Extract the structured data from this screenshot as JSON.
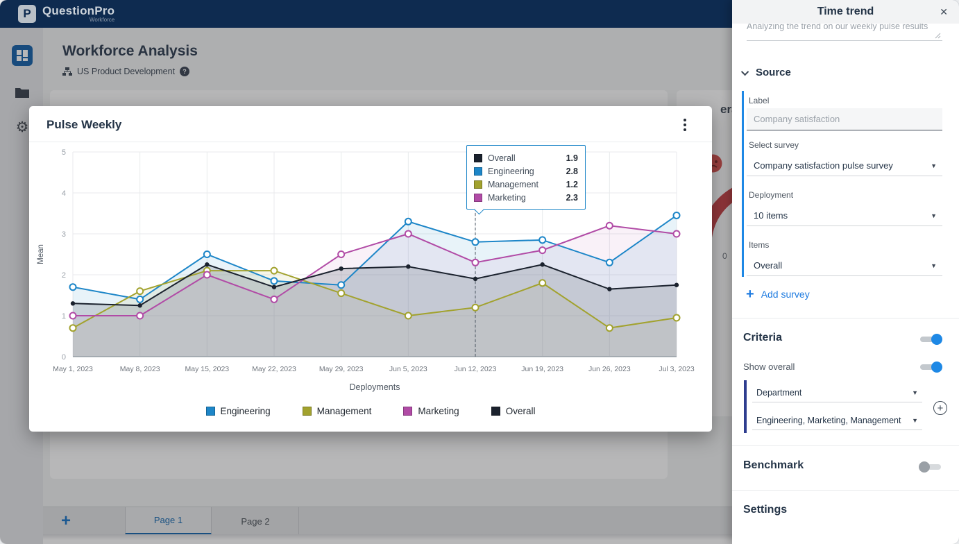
{
  "navbar": {
    "brand": "QuestionPro",
    "brand_sub": "Workforce",
    "logo_letter": "P"
  },
  "page": {
    "title": "Workforce Analysis",
    "breadcrumb": "US Product Development",
    "help": "?"
  },
  "background": {
    "card_title_fragment": "era",
    "gauge_tick": "0"
  },
  "tabs": {
    "add": "+",
    "page1": "Page 1",
    "page2": "Page 2"
  },
  "modal": {
    "title": "Pulse Weekly"
  },
  "chart_data": {
    "type": "line",
    "title": "Pulse Weekly",
    "xlabel": "Deployments",
    "ylabel": "Mean",
    "ylim": [
      0,
      5
    ],
    "grid": true,
    "legend_position": "bottom",
    "x": [
      "May 1, 2023",
      "May 8, 2023",
      "May 15, 2023",
      "May 22, 2023",
      "May 29, 2023",
      "Jun 5, 2023",
      "Jun 12, 2023",
      "Jun 19, 2023",
      "Jun 26, 2023",
      "Jul 3, 2023"
    ],
    "series": [
      {
        "name": "Engineering",
        "color": "#1d86c8",
        "fill": "rgba(29,134,200,0.10)",
        "marker": "open",
        "values": [
          1.7,
          1.4,
          2.5,
          1.85,
          1.75,
          3.3,
          2.8,
          2.85,
          2.3,
          3.45
        ]
      },
      {
        "name": "Management",
        "color": "#a2a22e",
        "fill": "rgba(162,162,46,0.10)",
        "marker": "open",
        "values": [
          0.7,
          1.6,
          2.1,
          2.1,
          1.55,
          1.0,
          1.2,
          1.8,
          0.7,
          0.95
        ]
      },
      {
        "name": "Marketing",
        "color": "#b14ba6",
        "fill": "rgba(177,75,166,0.08)",
        "marker": "open",
        "values": [
          1.0,
          1.0,
          2.0,
          1.4,
          2.5,
          3.0,
          2.3,
          2.6,
          3.2,
          3.0
        ]
      },
      {
        "name": "Overall",
        "color": "#1b222e",
        "fill": "rgba(120,127,137,0.28)",
        "marker": "filled",
        "values": [
          1.3,
          1.25,
          2.25,
          1.7,
          2.15,
          2.2,
          1.9,
          2.25,
          1.65,
          1.75
        ]
      }
    ],
    "legend_order": [
      "Engineering",
      "Management",
      "Marketing",
      "Overall"
    ],
    "cursor_index": 6,
    "tooltip": {
      "x": "Jun 12, 2023",
      "rows": [
        {
          "name": "Overall",
          "value": "1.9"
        },
        {
          "name": "Engineering",
          "value": "2.8"
        },
        {
          "name": "Management",
          "value": "1.2"
        },
        {
          "name": "Marketing",
          "value": "2.3"
        }
      ]
    }
  },
  "panel": {
    "title": "Time trend",
    "close_icon": "✕",
    "description": "Analyzing the trend on our weekly pulse results",
    "source": {
      "header": "Source",
      "label_label": "Label",
      "label_placeholder": "Company satisfaction",
      "survey_label": "Select survey",
      "survey_value": "Company satisfaction pulse survey",
      "deployment_label": "Deployment",
      "deployment_value": "10 items",
      "items_label": "Items",
      "items_value": "Overall",
      "add_survey": "Add survey"
    },
    "criteria": {
      "header": "Criteria",
      "show_overall": "Show overall",
      "field1": "Department",
      "field2": "Engineering, Marketing, Management"
    },
    "benchmark": {
      "header": "Benchmark"
    },
    "settings": {
      "header": "Settings"
    }
  }
}
